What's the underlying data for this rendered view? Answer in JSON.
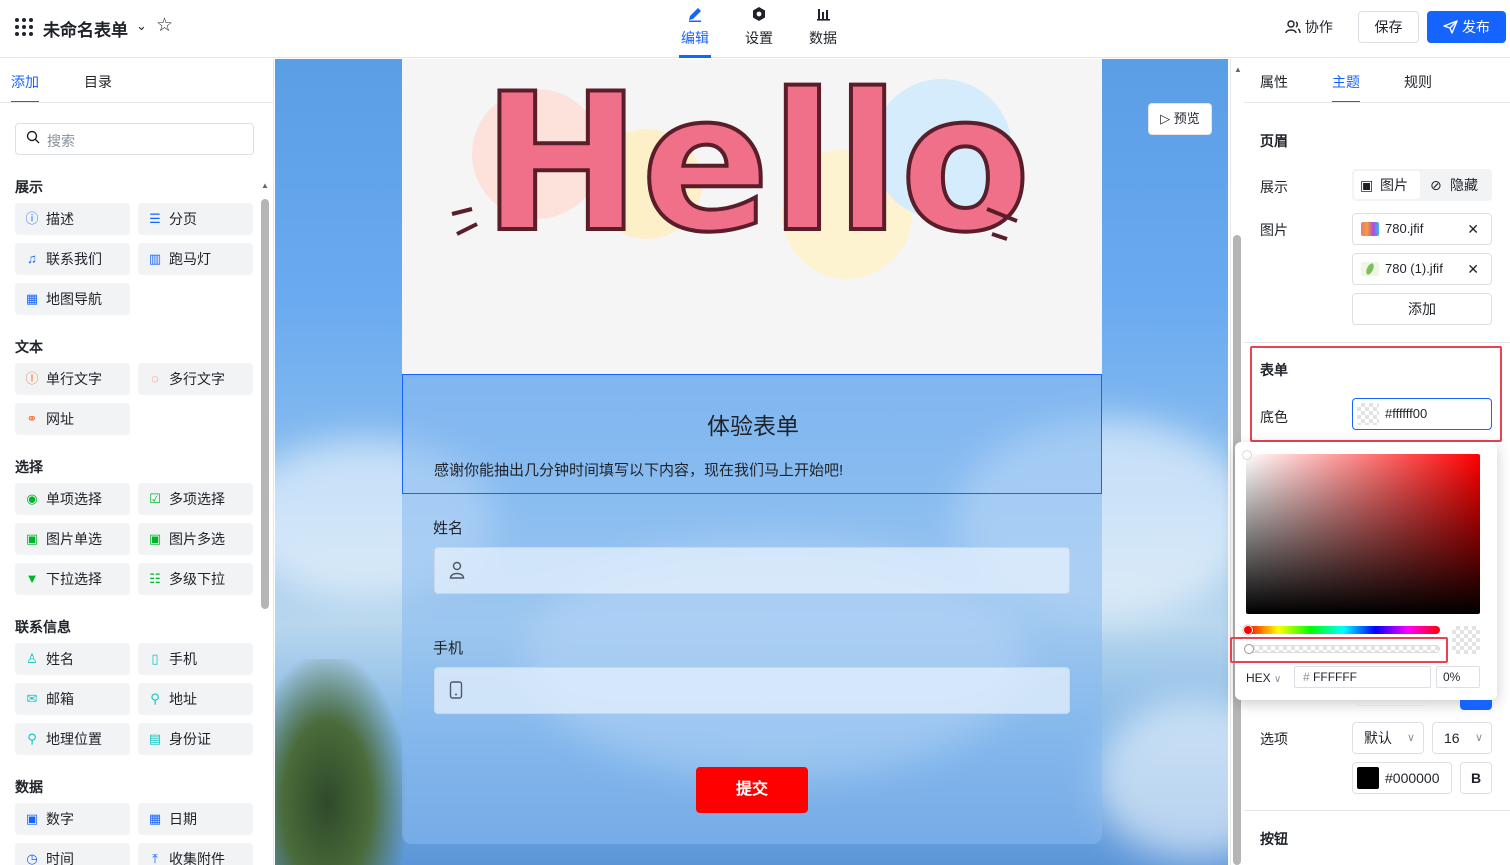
{
  "topbar": {
    "form_title": "未命名表单",
    "tabs": [
      {
        "label": "编辑",
        "icon": "pen-icon"
      },
      {
        "label": "设置",
        "icon": "hexagon-settings-icon"
      },
      {
        "label": "数据",
        "icon": "bar-chart-icon"
      }
    ],
    "collab_label": "协作",
    "save_label": "保存",
    "publish_label": "发布"
  },
  "left": {
    "tabs": [
      "添加",
      "目录"
    ],
    "search_placeholder": "搜索",
    "sections": [
      {
        "title": "展示",
        "items": [
          "描述",
          "分页",
          "联系我们",
          "跑马灯",
          "地图导航"
        ]
      },
      {
        "title": "文本",
        "items": [
          "单行文字",
          "多行文字",
          "网址"
        ]
      },
      {
        "title": "选择",
        "items": [
          "单项选择",
          "多项选择",
          "图片单选",
          "图片多选",
          "下拉选择",
          "多级下拉"
        ]
      },
      {
        "title": "联系信息",
        "items": [
          "姓名",
          "手机",
          "邮箱",
          "地址",
          "地理位置",
          "身份证"
        ]
      },
      {
        "title": "数据",
        "items": [
          "数字",
          "日期",
          "时间",
          "收集附件"
        ]
      }
    ]
  },
  "canvas": {
    "preview_label": "预览",
    "header_art_text": "Hello",
    "form_heading": "体验表单",
    "form_desc": "感谢你能抽出几分钟时间填写以下内容，现在我们马上开始吧!",
    "fields": [
      {
        "label": "姓名",
        "icon": "user-icon"
      },
      {
        "label": "手机",
        "icon": "phone-icon"
      }
    ],
    "submit_label": "提交"
  },
  "right": {
    "tabs": [
      "属性",
      "主题",
      "规则"
    ],
    "header_section": "页眉",
    "display_label": "展示",
    "display_options": [
      "图片",
      "隐藏"
    ],
    "image_label": "图片",
    "files": [
      "780.jfif",
      "780 (1).jfif"
    ],
    "add_label": "添加",
    "form_section": "表单",
    "bg_color_label": "底色",
    "bg_color_value": "#ffffff00",
    "option_label": "选项",
    "option_font": "默认",
    "option_size": "16",
    "option_color": "#000000",
    "bold_label": "B",
    "button_section": "按钮"
  },
  "picker": {
    "mode": "HEX",
    "hash": "#",
    "hex": "FFFFFF",
    "alpha": "0%"
  },
  "colors": {
    "accent": "#1664ff",
    "submit": "#ff0000",
    "highlight_box": "#e8434e"
  }
}
